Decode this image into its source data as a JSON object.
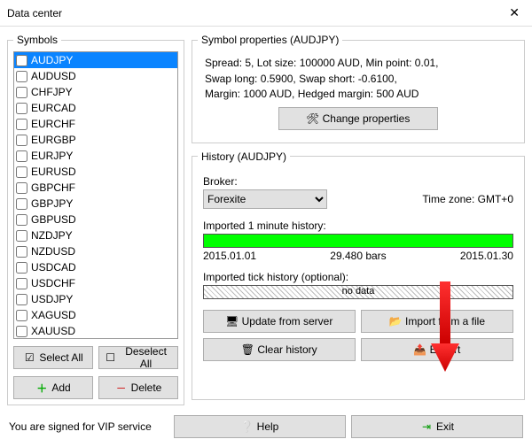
{
  "window": {
    "title": "Data center"
  },
  "symbols": {
    "legend": "Symbols",
    "items": [
      {
        "name": "AUDJPY",
        "selected": true
      },
      {
        "name": "AUDUSD"
      },
      {
        "name": "CHFJPY"
      },
      {
        "name": "EURCAD"
      },
      {
        "name": "EURCHF"
      },
      {
        "name": "EURGBP"
      },
      {
        "name": "EURJPY"
      },
      {
        "name": "EURUSD"
      },
      {
        "name": "GBPCHF"
      },
      {
        "name": "GBPJPY"
      },
      {
        "name": "GBPUSD"
      },
      {
        "name": "NZDJPY"
      },
      {
        "name": "NZDUSD"
      },
      {
        "name": "USDCAD"
      },
      {
        "name": "USDCHF"
      },
      {
        "name": "USDJPY"
      },
      {
        "name": "XAGUSD"
      },
      {
        "name": "XAUUSD"
      }
    ],
    "select_all": "Select All",
    "deselect_all": "Deselect All",
    "add": "Add",
    "delete": "Delete"
  },
  "properties": {
    "legend": "Symbol properties (AUDJPY)",
    "line1": "Spread: 5, Lot size: 100000 AUD, Min point: 0.01,",
    "line2": "Swap long: 0.5900, Swap short: -0.6100,",
    "line3": "Margin: 1000 AUD, Hedged margin: 500 AUD",
    "change_btn": "Change properties"
  },
  "history": {
    "legend": "History (AUDJPY)",
    "broker_label": "Broker:",
    "broker_value": "Forexite",
    "timezone": "Time zone: GMT+0",
    "minute_label": "Imported 1 minute history:",
    "minute_from": "2015.01.01",
    "minute_bars": "29.480 bars",
    "minute_to": "2015.01.30",
    "tick_label": "Imported tick history (optional):",
    "tick_nodata": "no data",
    "update_btn": "Update from server",
    "import_btn": "Import from a file",
    "clear_btn": "Clear history",
    "export_btn": "Export"
  },
  "footer": {
    "signed": "You are signed for VIP service",
    "help": "Help",
    "exit": "Exit"
  }
}
